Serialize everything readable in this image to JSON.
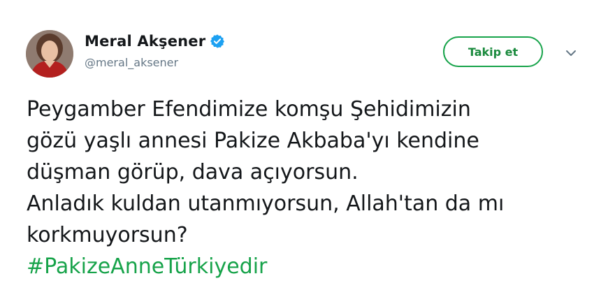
{
  "tweet": {
    "display_name": "Meral Akşener",
    "handle": "@meral_aksener",
    "verified": true,
    "follow_label": "Takip et",
    "text_lines": [
      "Peygamber Efendimize komşu Şehidimizin",
      "gözü yaşlı annesi Pakize Akbaba'yı kendine",
      "düşman görüp, dava açıyorsun.",
      "Anladık kuldan utanmıyorsun, Allah'tan da mı",
      "korkmuyorsun?"
    ],
    "hashtag": "#PakizeAnneTürkiyedir",
    "icons": {
      "verified": "verified-badge-icon",
      "menu": "chevron-down-icon"
    },
    "colors": {
      "accent": "#17a34a",
      "verified_badge": "#1da1f2",
      "handle": "#657786",
      "text": "#14171a"
    }
  }
}
